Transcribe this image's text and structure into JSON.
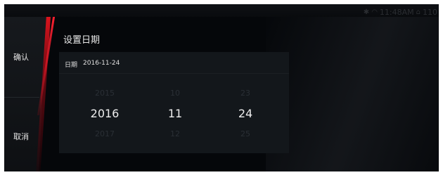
{
  "status": {
    "time": "11:48AM",
    "battery": "110"
  },
  "sidebar": {
    "confirm_label": "确认",
    "cancel_label": "取消"
  },
  "dialog": {
    "title": "设置日期",
    "date_label": "日期",
    "date_value": "2016-11-24"
  },
  "picker": {
    "year": {
      "prev": "2015",
      "selected": "2016",
      "next": "2017"
    },
    "month": {
      "prev": "10",
      "selected": "11",
      "next": "12"
    },
    "day": {
      "prev": "23",
      "selected": "24",
      "next": "25"
    }
  },
  "colors": {
    "accent_red": "#e6141e",
    "background": "#05070a",
    "panel": "#13171b"
  }
}
